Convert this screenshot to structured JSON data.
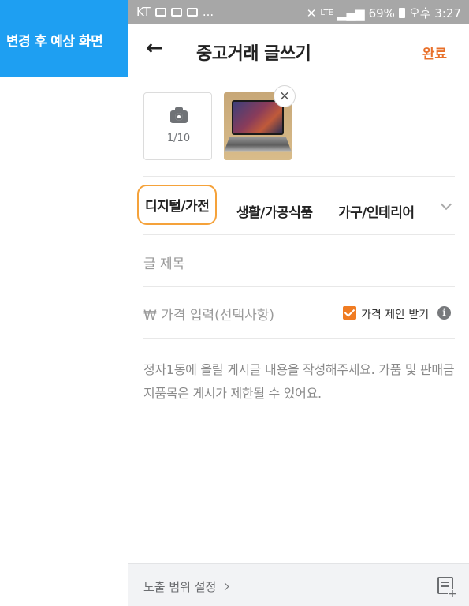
{
  "annotation": {
    "label": "변경 후 예상 화면"
  },
  "status_bar": {
    "carrier": "KT",
    "left_more": "...",
    "lte": "LTE",
    "battery": "69%",
    "time": "오후 3:27"
  },
  "header": {
    "back_icon": "arrow-left-icon",
    "title": "중고거래 글쓰기",
    "done_label": "완료",
    "done_color": "#e8702a"
  },
  "photos": {
    "count": "1/10",
    "remove_label": "×"
  },
  "categories": {
    "items": [
      {
        "label": "디지털/가전",
        "selected": true
      },
      {
        "label": "생활/가공식품",
        "selected": false
      },
      {
        "label": "가구/인테리어",
        "selected": false
      }
    ],
    "highlight_color": "#f5a23a"
  },
  "form": {
    "title_placeholder": "글 제목",
    "price_placeholder": "₩ 가격 입력(선택사항)",
    "price_offer_label": "가격 제안 받기",
    "price_offer_checked": true,
    "info_icon_label": "i",
    "content_placeholder": "정자1동에 올릴 게시글 내용을 작성해주세요. 가품 및 판매금지품목은 게시가 제한될 수 있어요."
  },
  "bottom_bar": {
    "visibility_label": "노출 범위 설정",
    "memo_icon": "memo-add-icon"
  },
  "colors": {
    "annotation_bg": "#1e9ff2",
    "status_bg": "#a7a7a7",
    "accent": "#f07c22"
  }
}
